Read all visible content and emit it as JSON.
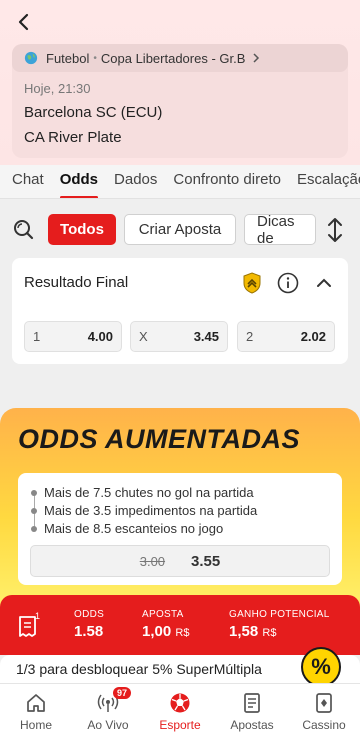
{
  "header": {
    "back_icon": "chevron-left-icon",
    "league_icon": "globe-icon",
    "sport": "Futebol",
    "separator": "•",
    "league": "Copa Libertadores - Gr.B",
    "time": "Hoje, 21:30",
    "home_team": "Barcelona SC (ECU)",
    "away_team": "CA River Plate"
  },
  "tabs": [
    {
      "label": "Chat"
    },
    {
      "label": "Odds",
      "active": true
    },
    {
      "label": "Dados"
    },
    {
      "label": "Confronto direto"
    },
    {
      "label": "Escalação"
    }
  ],
  "filters": {
    "search_icon": "search-icon",
    "chips": [
      "Todos",
      "Criar Aposta",
      "Dicas de"
    ],
    "sort_icon": "sort-arrows-icon"
  },
  "market": {
    "title": "Resultado Final",
    "odds": [
      {
        "label": "1",
        "value": "4.00"
      },
      {
        "label": "X",
        "value": "3.45"
      },
      {
        "label": "2",
        "value": "2.02"
      }
    ]
  },
  "boost": {
    "title": "ODDS AUMENTADAS",
    "selections": [
      "Mais de 7.5 chutes no gol na partida",
      "Mais de 3.5 impedimentos na partida",
      "Mais de 8.5 escanteios no jogo"
    ],
    "old_odd": "3.00",
    "new_odd": "3.55"
  },
  "betslip": {
    "count": "1",
    "odds_label": "ODDS",
    "odds_value": "1.58",
    "stake_label": "APOSTA",
    "stake_value": "1,00",
    "potential_label": "GANHO POTENCIAL",
    "potential_value": "1,58",
    "currency": "R$"
  },
  "promo": {
    "text": "1/3 para desbloquear 5% SuperMúltipla",
    "badge": "%"
  },
  "bottom_nav": [
    {
      "label": "Home",
      "icon": "home-icon"
    },
    {
      "label": "Ao Vivo",
      "icon": "live-icon",
      "badge": "97"
    },
    {
      "label": "Esporte",
      "icon": "soccer-ball-icon",
      "active": true
    },
    {
      "label": "Apostas",
      "icon": "receipt-icon"
    },
    {
      "label": "Cassino",
      "icon": "cards-icon"
    }
  ],
  "colors": {
    "accent": "#e51d1d",
    "boost_yellow": "#ffd940"
  }
}
